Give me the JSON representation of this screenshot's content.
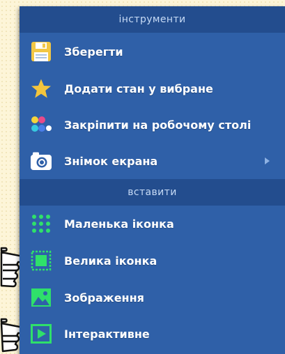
{
  "colors": {
    "menu_bg": "#2f60a8",
    "header_bg": "#234d8e",
    "header_text": "#c7dbf6",
    "item_text": "#ffffff",
    "accent_green": "#2fe06a",
    "page_bg": "#fdf5d8"
  },
  "sections": [
    {
      "title": "інструменти",
      "items": [
        {
          "label": "Зберегти",
          "icon": "floppy-disk-icon"
        },
        {
          "label": "Додати стан у вибране",
          "icon": "star-icon"
        },
        {
          "label": "Закріпити на робочому столі",
          "icon": "color-dots-icon"
        },
        {
          "label": "Знімок екрана",
          "icon": "camera-icon",
          "has_submenu": true
        }
      ]
    },
    {
      "title": "вставити",
      "items": [
        {
          "label": "Маленька іконка",
          "icon": "dot-grid-icon"
        },
        {
          "label": "Велика іконка",
          "icon": "big-icon-frame-icon"
        },
        {
          "label": "Зображення",
          "icon": "image-icon"
        },
        {
          "label": "Інтерактивне",
          "icon": "play-icon"
        }
      ]
    }
  ]
}
